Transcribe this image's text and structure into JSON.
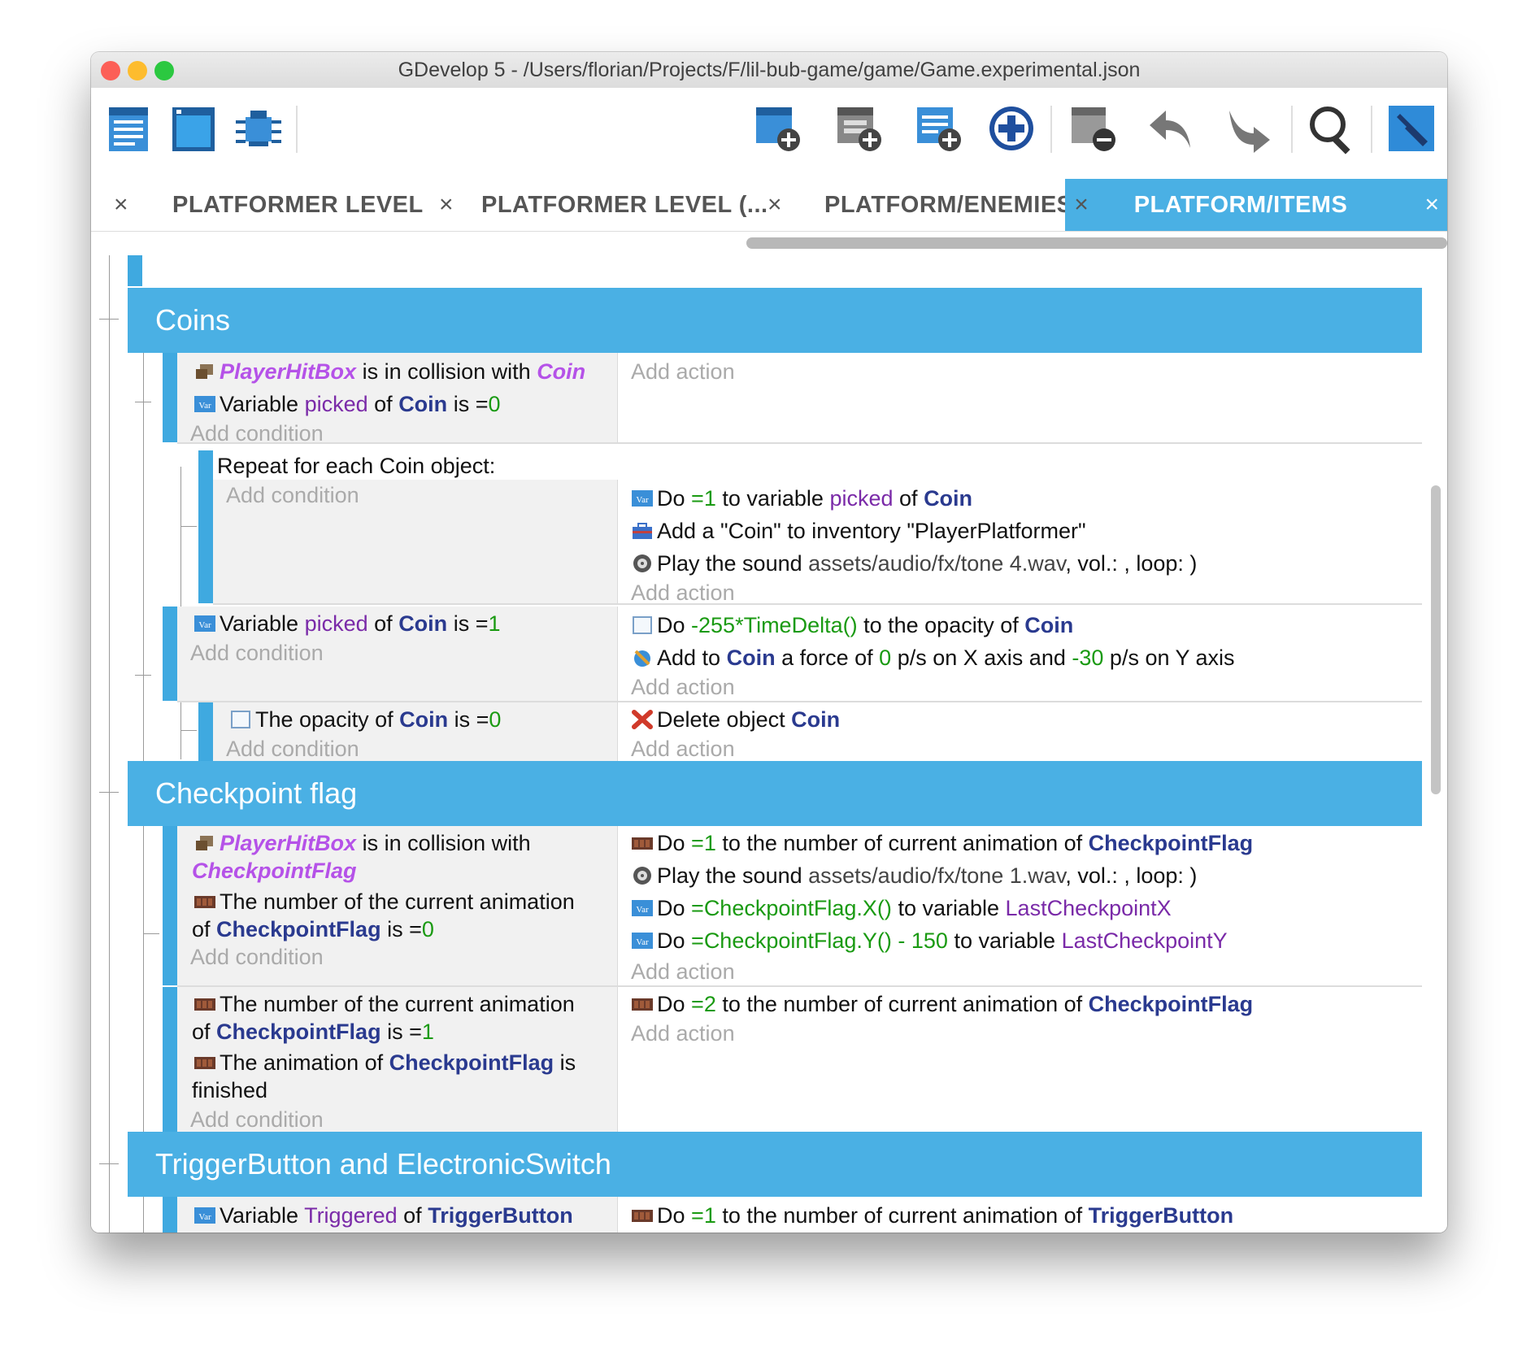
{
  "window": {
    "title": "GDevelop 5 - /Users/florian/Projects/F/lil-bub-game/game/Game.experimental.json"
  },
  "colors": {
    "accent": "#4ab0e4",
    "object": "#2a3a8f",
    "object_italic": "#b552e8",
    "variable": "#7a2aa8",
    "number": "#1a9a12"
  },
  "toolbar": {
    "left_icons": [
      "project-manager-icon",
      "scene-editor-icon",
      "debugger-icon"
    ],
    "right_icons": [
      "add-event-icon",
      "add-subevent-icon",
      "add-comment-icon",
      "add-other-icon",
      "delete-event-icon",
      "undo-icon",
      "redo-icon",
      "search-icon",
      "settings-wrench-icon"
    ]
  },
  "tabs": [
    {
      "label": "PLATFORMER LEVEL",
      "close": "×"
    },
    {
      "label": "PLATFORMER LEVEL (...",
      "close": "×"
    },
    {
      "label": "PLATFORM/ENEMIES",
      "close": "×"
    },
    {
      "label": "PLATFORM/ITEMS",
      "close": "×"
    }
  ],
  "common": {
    "add_condition": "Add condition",
    "add_action": "Add action",
    "is": "is",
    "eq": "=",
    "of": "of",
    "do": "Do",
    "to_variable": "to variable",
    "collision": "is in collision with",
    "variable": "Variable",
    "anim_num_cond": "The number of the current animation",
    "to_num_anim": "to the number of current animation of",
    "play_sound": "Play the sound",
    "vol_loop": ", vol.: , loop: )"
  },
  "groups": {
    "coins": "Coins",
    "checkpoint": "Checkpoint flag",
    "trigger": "TriggerButton and ElectronicSwitch"
  },
  "e1": {
    "obj1": "PlayerHitBox",
    "obj2": "Coin",
    "var": "picked",
    "val": "0"
  },
  "e2": {
    "repeat": "Repeat for each Coin object:",
    "do_val": "1",
    "var": "picked",
    "obj": "Coin",
    "inv_text": "Add a \"Coin\" to inventory \"PlayerPlatformer\"",
    "sound": "assets/audio/fx/tone 4.wav"
  },
  "e3": {
    "var": "picked",
    "obj": "Coin",
    "val": "1",
    "expr": "-255*TimeDelta()",
    "opacity_text": "to the opacity of",
    "force_add": "Add to",
    "force_text": "a force of",
    "fx": "0",
    "ps_x": "p/s on X axis and",
    "fy": "-30",
    "ps_y": "p/s on Y axis"
  },
  "e4": {
    "cond_text": "The opacity of",
    "obj": "Coin",
    "val": "0",
    "delete": "Delete object"
  },
  "e5": {
    "obj1": "PlayerHitBox",
    "obj2": "CheckpointFlag",
    "val": "0",
    "do_val": "1",
    "sound": "assets/audio/fx/tone 1.wav",
    "expr_x": "CheckpointFlag.X()",
    "var_x": "LastCheckpointX",
    "expr_y": "CheckpointFlag.Y() - 150",
    "var_y": "LastCheckpointY"
  },
  "e6": {
    "obj": "CheckpointFlag",
    "val": "1",
    "anim_fin_a": "The animation of",
    "anim_fin_b": "is",
    "finished": "finished",
    "do_val": "2"
  },
  "e7": {
    "var": "Triggered",
    "obj": "TriggerButton",
    "do_val": "1"
  }
}
